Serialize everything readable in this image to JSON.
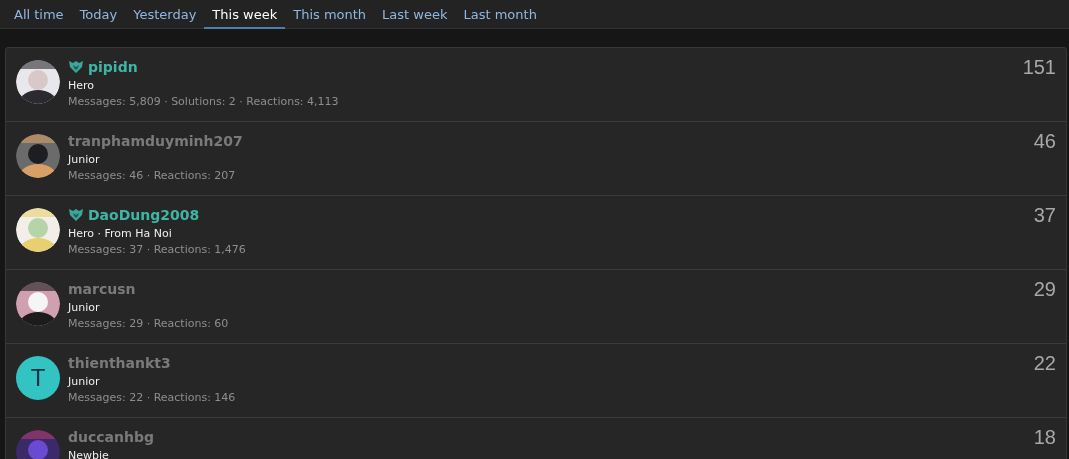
{
  "tabs": [
    {
      "label": "All time",
      "selected": false
    },
    {
      "label": "Today",
      "selected": false
    },
    {
      "label": "Yesterday",
      "selected": false
    },
    {
      "label": "This week",
      "selected": true
    },
    {
      "label": "This month",
      "selected": false
    },
    {
      "label": "Last week",
      "selected": false
    },
    {
      "label": "Last month",
      "selected": false
    }
  ],
  "members": [
    {
      "emblem": true,
      "name": "pipidn",
      "title": "Hero",
      "stats": "Messages: 5,809 · Solutions: 2 · Reactions: 4,113",
      "count": "151"
    },
    {
      "emblem": false,
      "name": "tranphamduyminh207",
      "title": "Junior",
      "stats": "Messages: 46 · Reactions: 207",
      "count": "46"
    },
    {
      "emblem": true,
      "name": "DaoDung2008",
      "title": "Hero · From Ha Noi",
      "stats": "Messages: 37 · Reactions: 1,476",
      "count": "37"
    },
    {
      "emblem": false,
      "name": "marcusn",
      "title": "Junior",
      "stats": "Messages: 29 · Reactions: 60",
      "count": "29"
    },
    {
      "avatar": {
        "kind": "letter",
        "letter": "T",
        "color": "#33c3c3"
      },
      "emblem": false,
      "name": "thienthankt3",
      "title": "Junior",
      "stats": "Messages: 22 · Reactions: 146",
      "count": "22"
    },
    {
      "emblem": false,
      "name": "duccanhbg",
      "title": "Newbie",
      "count": "18"
    }
  ]
}
